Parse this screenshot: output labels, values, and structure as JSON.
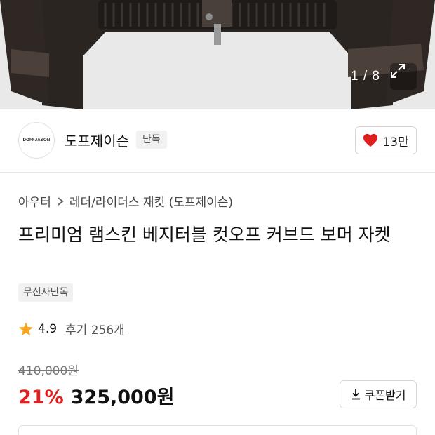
{
  "gallery": {
    "counter": "1 / 8",
    "image_alt": "leather-jacket-image",
    "expand_icon": "expand-icon"
  },
  "brand": {
    "logo_text": "DOFFJASON",
    "name": "도프제이슨",
    "badge": "단독",
    "like_count": "13만",
    "like_icon": "heart-icon",
    "like_color": "#e0201f"
  },
  "breadcrumb": {
    "category": "아우터",
    "separator_icon": "chevron-right-icon",
    "subcategory": "레더/라이더스 재킷 (도프제이슨)"
  },
  "product": {
    "title": "프리미엄 램스킨 베지터블 컷오프 커브드 보머 자켓",
    "tag": "무신사단독"
  },
  "rating": {
    "icon": "star-icon",
    "star_color": "#f5a623",
    "score": "4.9",
    "reviews": "후기 256개"
  },
  "price": {
    "original": "410,000원",
    "discount": "21%",
    "sale": "325,000원",
    "discount_color": "#e0201f",
    "coupon_label": "쿠폰받기",
    "coupon_icon": "download-icon"
  }
}
